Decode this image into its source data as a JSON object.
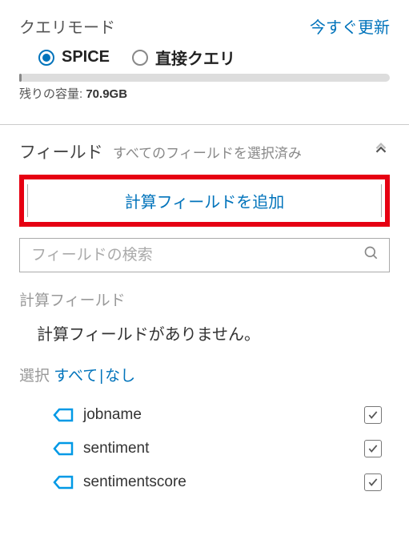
{
  "query_mode": {
    "title": "クエリモード",
    "refresh": "今すぐ更新",
    "options": {
      "spice": "SPICE",
      "direct": "直接クエリ"
    },
    "capacity_label": "残りの容量:",
    "capacity_value": "70.9GB"
  },
  "fields_panel": {
    "title": "フィールド",
    "subtitle": "すべてのフィールドを選択済み",
    "add_calc": "計算フィールドを追加",
    "search_placeholder": "フィールドの検索",
    "calc_title": "計算フィールド",
    "calc_empty": "計算フィールドがありません。",
    "select_label": "選択",
    "select_all": "すべて",
    "select_none": "なし",
    "fields": [
      {
        "name": "jobname"
      },
      {
        "name": "sentiment"
      },
      {
        "name": "sentimentscore"
      }
    ]
  }
}
